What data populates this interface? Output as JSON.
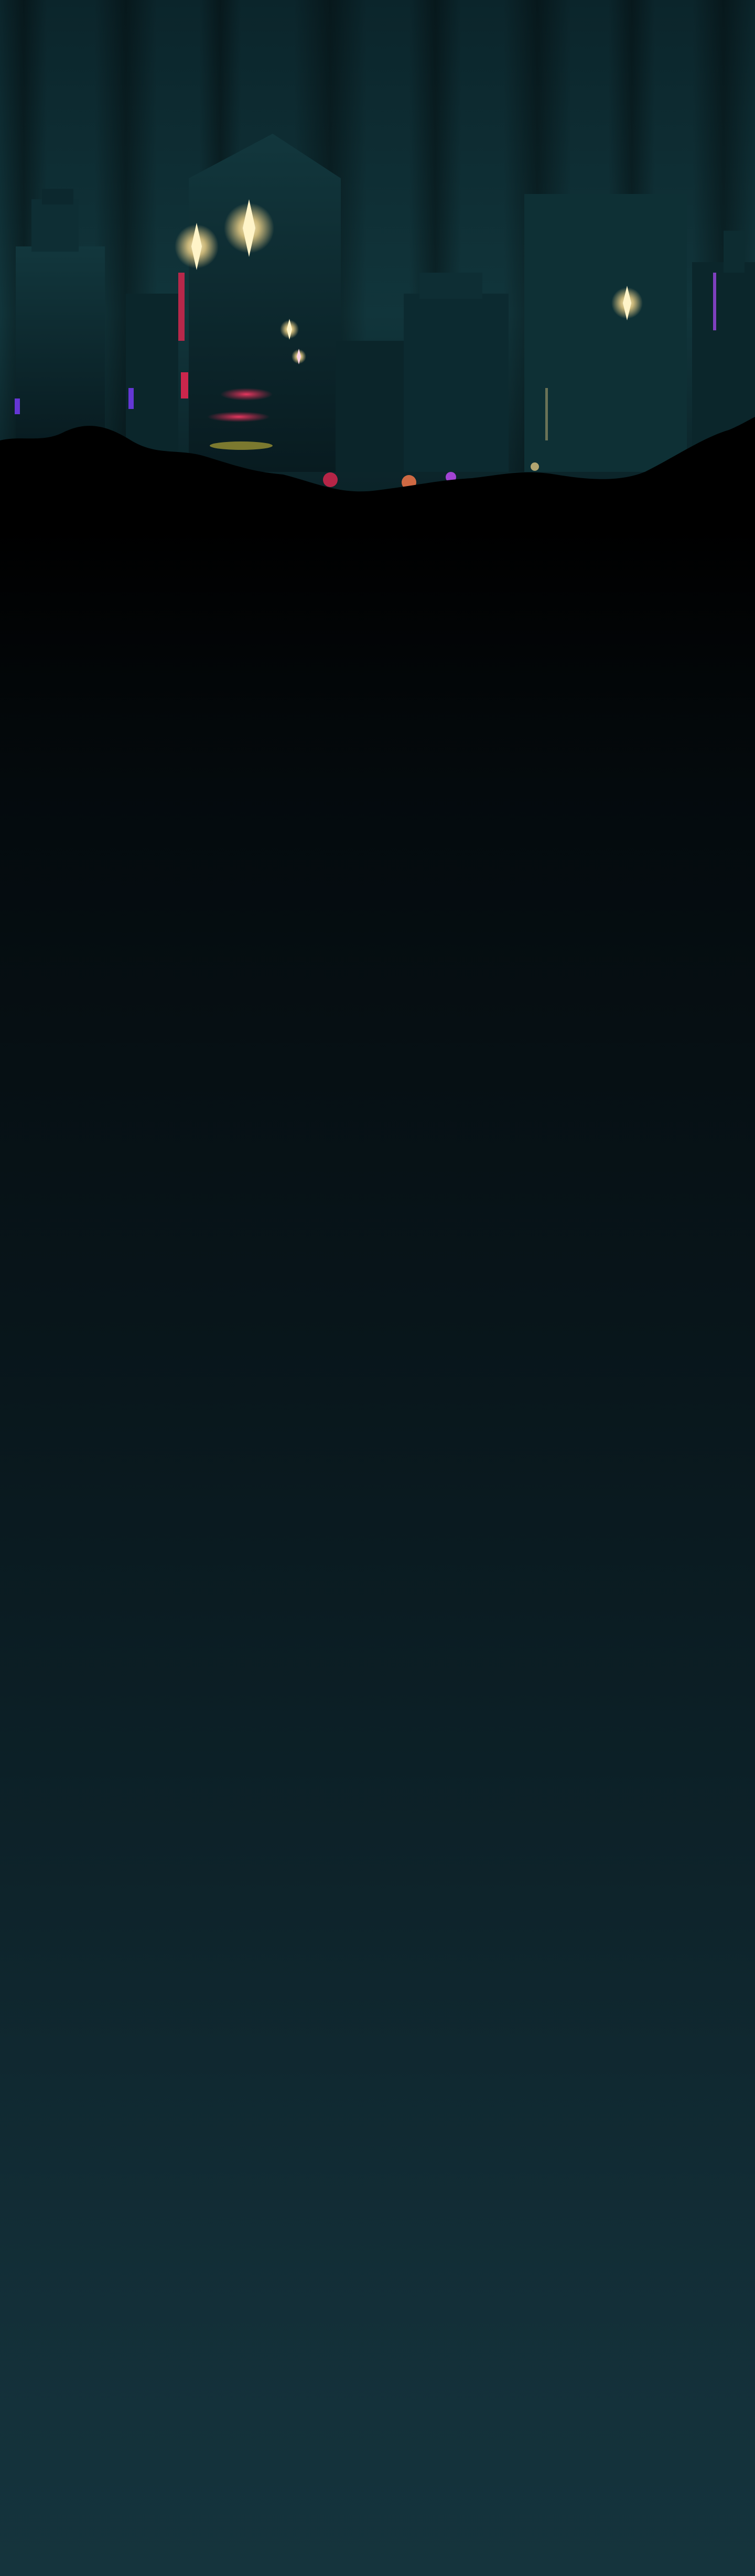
{
  "scene": {
    "description_colors": {
      "sky_top": "#0c2a30",
      "sky_mid": "#123a40",
      "curtain_shadow": "#071a1f",
      "building_dark": "#0a2328",
      "building_mid": "#0f3036",
      "window_warm": "#f6d78a",
      "neon_red": "#e0264f",
      "neon_purple": "#7b3cff",
      "neon_yellow": "#d8c43a",
      "horizon_black": "#000000",
      "bottom_teal": "#15343d"
    },
    "icons": [
      "sparkle-icon"
    ]
  }
}
